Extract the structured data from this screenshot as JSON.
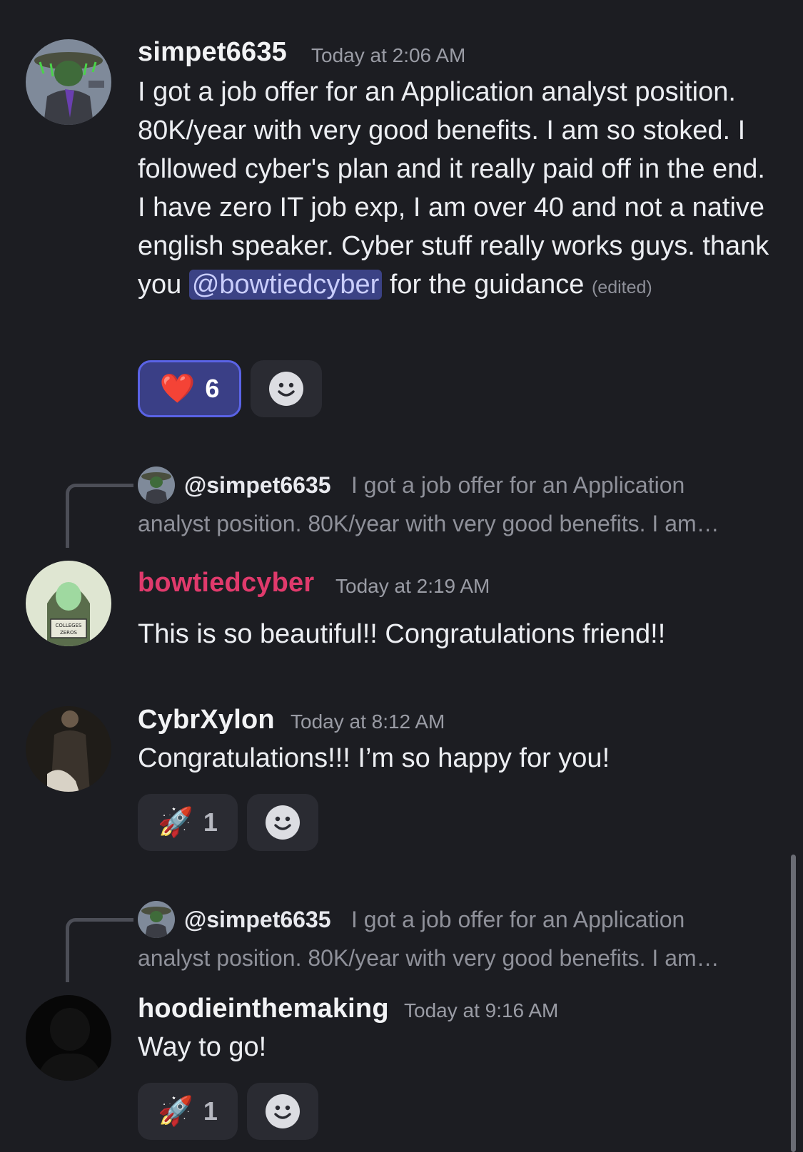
{
  "messages": [
    {
      "username": "simpet6635",
      "username_color": "#f2f3f5",
      "timestamp": "Today at 2:06 AM",
      "text_before_mention": "I got a job offer for an Application analyst position. 80K/year with very good benefits. I am so stoked. I followed cyber's plan and it really paid off in the end. I have zero IT job exp, I am over 40 and not a native english speaker. Cyber stuff really works guys. thank you ",
      "mention": "@bowtiedcyber",
      "text_after_mention": " for the guidance",
      "edited": "(edited)",
      "reaction": {
        "emoji": "❤️",
        "count": "6"
      }
    },
    {
      "username": "bowtiedcyber",
      "username_color": "#e03a6c",
      "timestamp": "Today at 2:19 AM",
      "reply": {
        "name": "@simpet6635",
        "line1": "I got a job offer for an Application",
        "line2": "analyst position. 80K/year with very good benefits. I am…"
      },
      "text": "This is so beautiful!! Congratulations friend!!",
      "avatar_label": "COLLEGES ZEROS"
    },
    {
      "username": "CybrXylon",
      "username_color": "#f2f3f5",
      "timestamp": "Today at 8:12 AM",
      "text": "Congratulations!!! I’m so happy for you!",
      "reaction": {
        "emoji": "🚀",
        "count": "1"
      }
    },
    {
      "username": "hoodieinthemaking",
      "username_color": "#f2f3f5",
      "timestamp": "Today at 9:16 AM",
      "reply": {
        "name": "@simpet6635",
        "line1": "I got a job offer for an Application",
        "line2": "analyst position. 80K/year with very good benefits. I am…"
      },
      "text": "Way to go!",
      "reaction": {
        "emoji": "🚀",
        "count": "1"
      }
    }
  ],
  "icons": {
    "add_reaction": "smiley-icon"
  },
  "colors": {
    "background": "#1c1d22",
    "mention_bg": "#3b4285",
    "active_reaction_border": "#5a63e6"
  }
}
